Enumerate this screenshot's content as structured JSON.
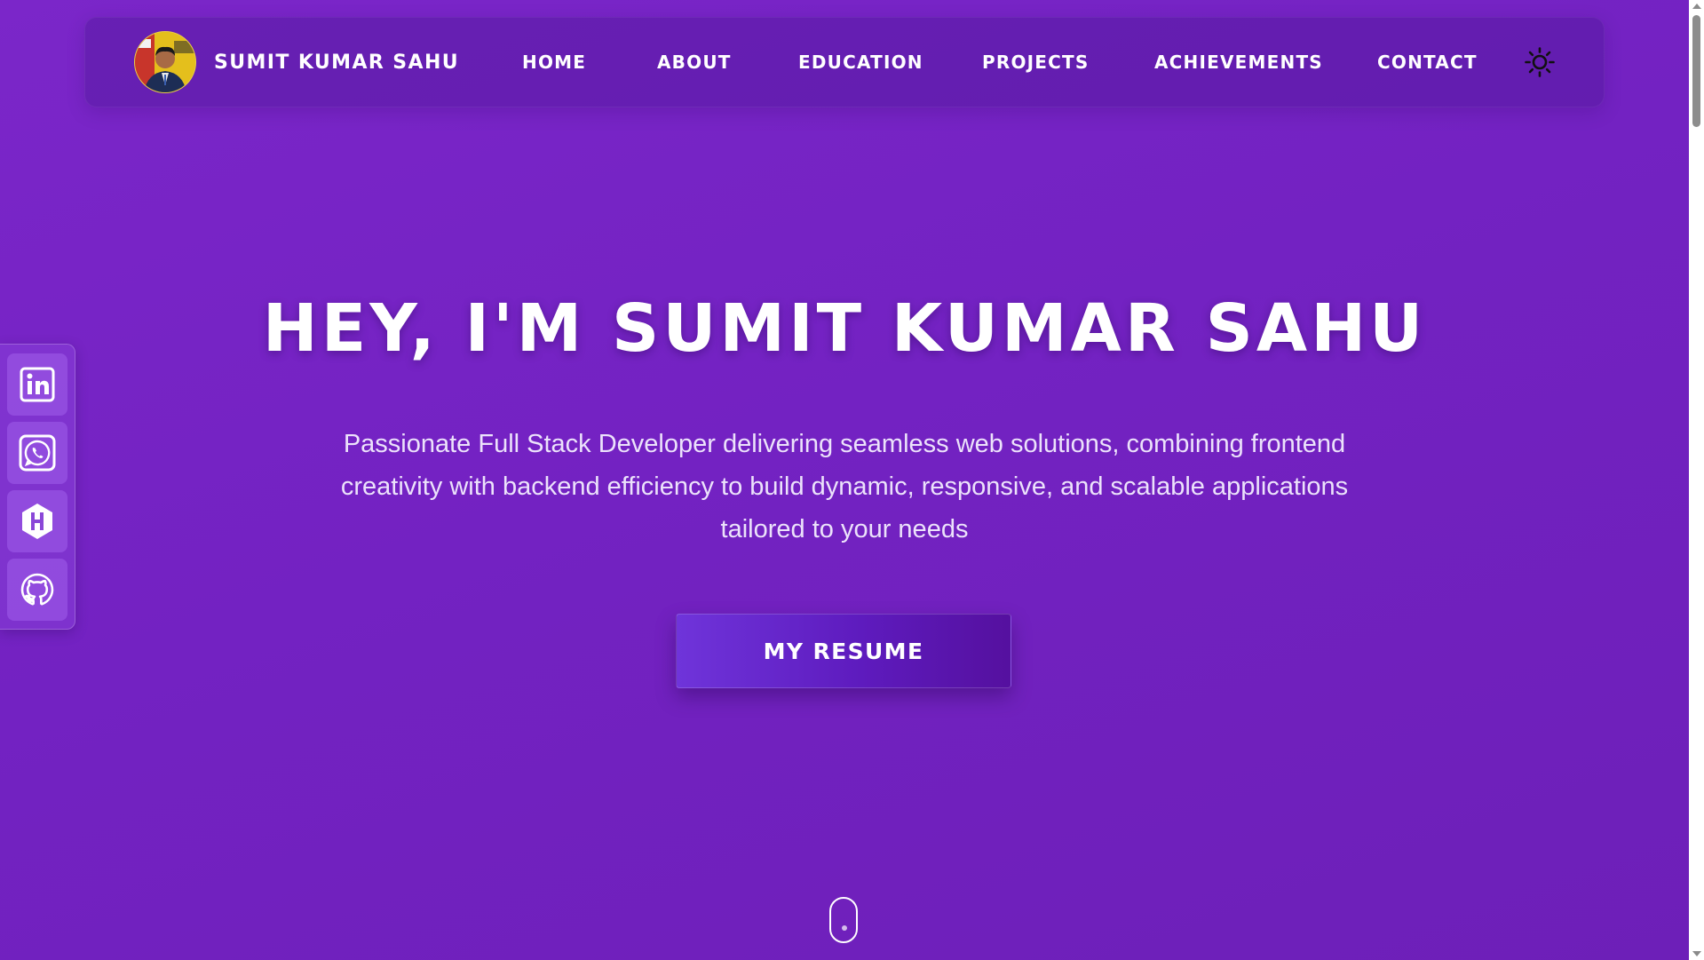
{
  "navbar": {
    "brand_name": "SUMIT KUMAR SAHU",
    "links": [
      {
        "label": "HOME"
      },
      {
        "label": "ABOUT"
      },
      {
        "label": "EDUCATION"
      },
      {
        "label": "PROJECTS"
      },
      {
        "label": "ACHIEVEMENTS"
      },
      {
        "label": "CONTACT"
      }
    ],
    "theme_toggle_icon": "sun-icon"
  },
  "hero": {
    "title": "HEY, I'M SUMIT KUMAR SAHU",
    "subtitle": "Passionate Full Stack Developer delivering seamless web solutions, combining frontend creativity with backend efficiency to build dynamic, responsive, and scalable applications tailored to your needs",
    "resume_button": "MY RESUME"
  },
  "social": [
    {
      "icon": "linkedin-icon"
    },
    {
      "icon": "whatsapp-icon"
    },
    {
      "icon": "hashnode-icon"
    },
    {
      "icon": "github-icon"
    }
  ],
  "colors": {
    "background": "#7322c2",
    "button_gradient_start": "#6f34da",
    "button_gradient_end": "#55109f",
    "text": "#ffffff"
  }
}
